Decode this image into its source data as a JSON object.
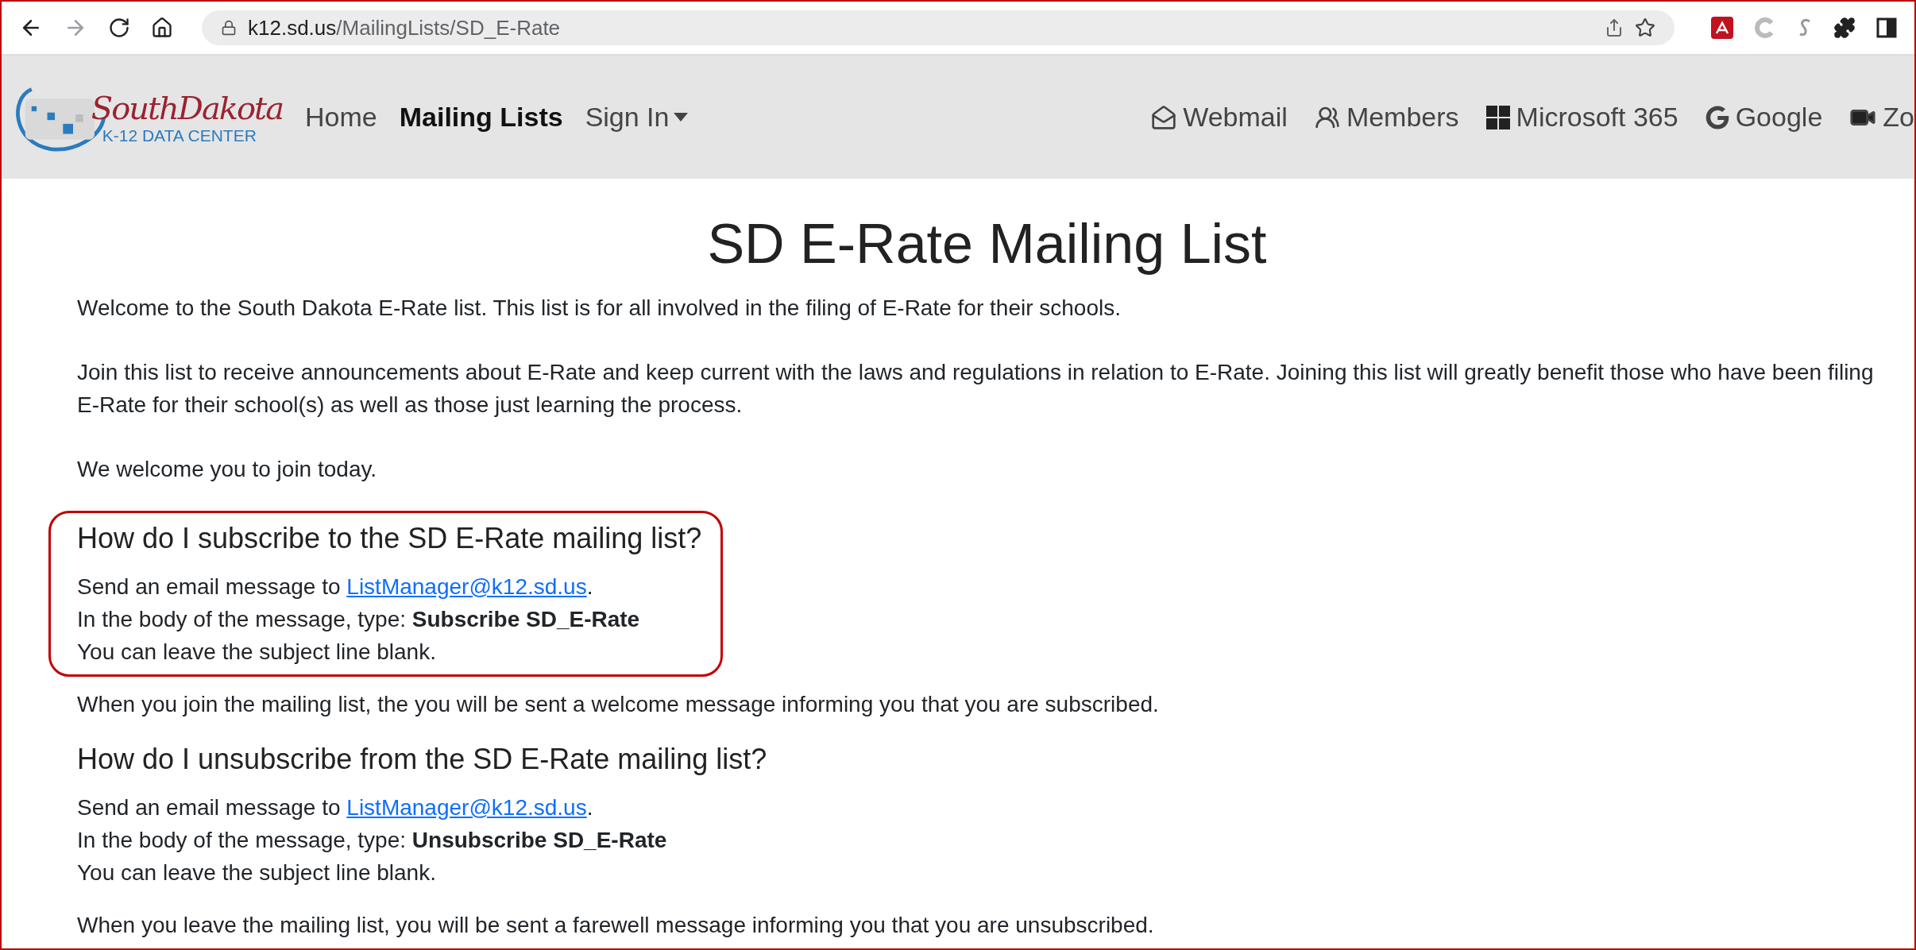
{
  "browser": {
    "url_host": "k12.sd.us",
    "url_path": "/MailingLists/SD_E-Rate"
  },
  "site_nav": {
    "logo": {
      "script": "SouthDakota",
      "subtitle": "K-12 DATA CENTER"
    },
    "links": [
      {
        "label": "Home",
        "selected": false,
        "dropdown": false
      },
      {
        "label": "Mailing Lists",
        "selected": true,
        "dropdown": false
      },
      {
        "label": "Sign In",
        "selected": false,
        "dropdown": true
      }
    ],
    "quick_links": [
      {
        "label": "Webmail",
        "kind": "mail"
      },
      {
        "label": "Members",
        "kind": "members"
      },
      {
        "label": "Microsoft 365",
        "kind": "windows"
      },
      {
        "label": "Google",
        "kind": "google"
      },
      {
        "label": "Zo",
        "kind": "video"
      }
    ]
  },
  "page": {
    "title": "SD E-Rate Mailing List",
    "intro": [
      "Welcome to the South Dakota E-Rate list. This list is for all involved in the filing of E-Rate for their schools.",
      "Join this list to receive announcements about E-Rate and keep current with the laws and regulations in relation to E-Rate. Joining this list will greatly benefit those who have been filing E-Rate for their school(s) as well as those just learning the process.",
      "We welcome you to join today."
    ],
    "sections": [
      {
        "heading": "How do I subscribe to the SD E-Rate mailing list?",
        "highlighted": true,
        "lines": [
          {
            "kind": "link",
            "text": "Send an email message to ",
            "link": "ListManager@k12.sd.us",
            "suffix": "."
          },
          {
            "kind": "text",
            "text": "In the body of the message, type: **Subscribe SD_E-Rate**"
          },
          {
            "kind": "text",
            "text": "You can leave the subject line blank."
          }
        ],
        "note": "When you join the mailing list, the you will be sent a welcome message informing you that you are subscribed."
      },
      {
        "heading": "How do I unsubscribe from the SD E-Rate mailing list?",
        "highlighted": false,
        "lines": [
          {
            "kind": "link",
            "text": "Send an email message to ",
            "link": "ListManager@k12.sd.us",
            "suffix": "."
          },
          {
            "kind": "text",
            "text": "In the body of the message, type: **Unsubscribe SD_E-Rate**"
          },
          {
            "kind": "text",
            "text": "You can leave the subject line blank."
          }
        ],
        "note": "When you leave the mailing list, you will be sent a farewell message informing you that you are unsubscribed."
      }
    ]
  }
}
